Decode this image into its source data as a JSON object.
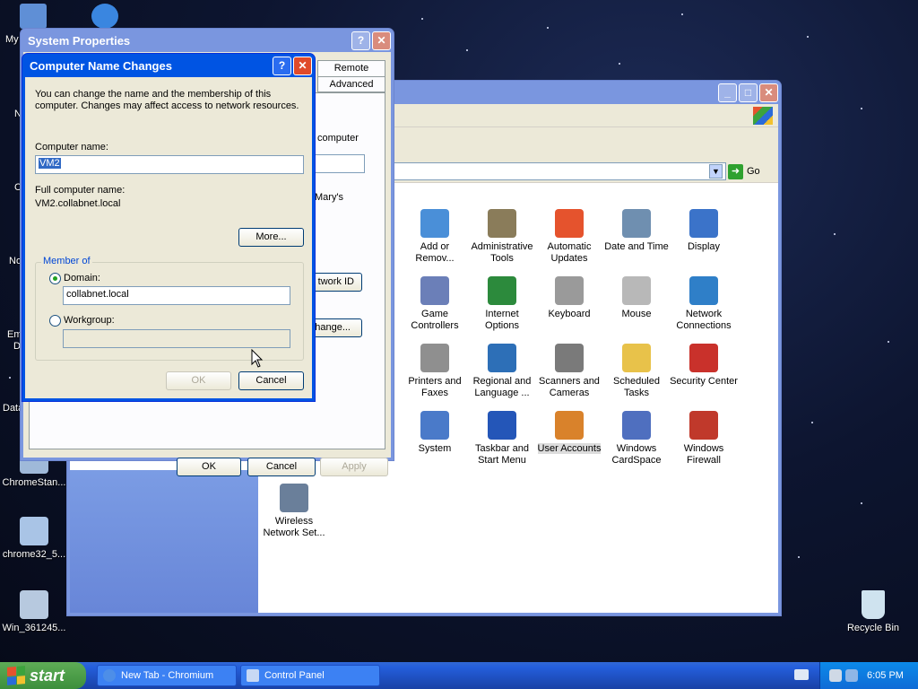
{
  "desktop": {
    "icons": [
      {
        "label": "My"
      },
      {
        "label": "N"
      },
      {
        "label": "C"
      },
      {
        "label": "No"
      },
      {
        "label": "Em"
      },
      {
        "label": "D"
      },
      {
        "label": "Data"
      },
      {
        "label": "ChromeStan..."
      },
      {
        "label": "chrome32_5..."
      },
      {
        "label": "Win_361245..."
      },
      {
        "label": "Recycle Bin"
      }
    ]
  },
  "system_properties": {
    "title": "System Properties",
    "tabs": [
      "Remote",
      "Advanced"
    ],
    "partial_texts": [
      "computer",
      "Mary's",
      "twork ID",
      "hange..."
    ],
    "buttons": {
      "ok": "OK",
      "cancel": "Cancel",
      "apply": "Apply"
    }
  },
  "computer_name_changes": {
    "title": "Computer Name Changes",
    "intro": "You can change the name and the membership of this computer. Changes may affect access to network resources.",
    "computer_name_label": "Computer name:",
    "computer_name_value": "VM2",
    "full_name_label": "Full computer name:",
    "full_name_value": "VM2.collabnet.local",
    "more_button": "More...",
    "member_of_label": "Member of",
    "domain_label": "Domain:",
    "domain_value": "collabnet.local",
    "workgroup_label": "Workgroup:",
    "workgroup_value": "",
    "ok_button": "OK",
    "cancel_button": "Cancel",
    "selected_membership": "Domain"
  },
  "control_panel": {
    "address_go": "Go",
    "items": [
      {
        "label": "Add or Remov...",
        "icon": "add-remove-programs-icon",
        "color": "#4a8fd8"
      },
      {
        "label": "Administrative Tools",
        "icon": "admin-tools-icon",
        "color": "#8a7c5a"
      },
      {
        "label": "Automatic Updates",
        "icon": "windows-flag-icon",
        "color": "#e5532d"
      },
      {
        "label": "Date and Time",
        "icon": "clock-icon",
        "color": "#6f8fb0"
      },
      {
        "label": "Display",
        "icon": "monitor-icon",
        "color": "#3b73c9"
      },
      {
        "label": "Game Controllers",
        "icon": "gamepad-icon",
        "color": "#6b7fb8"
      },
      {
        "label": "Internet Options",
        "icon": "globe-icon",
        "color": "#2c8a3c"
      },
      {
        "label": "Keyboard",
        "icon": "keyboard-icon",
        "color": "#9a9a9a"
      },
      {
        "label": "Mouse",
        "icon": "mouse-icon",
        "color": "#b8b8b8"
      },
      {
        "label": "Network Connections",
        "icon": "network-globe-icon",
        "color": "#2f7fc8"
      },
      {
        "label": "Printers and Faxes",
        "icon": "printer-icon",
        "color": "#8f8f8f"
      },
      {
        "label": "Regional and Language ...",
        "icon": "regional-globe-icon",
        "color": "#2d6fb7"
      },
      {
        "label": "Scanners and Cameras",
        "icon": "scanner-camera-icon",
        "color": "#7a7a7a"
      },
      {
        "label": "Scheduled Tasks",
        "icon": "scheduled-folder-icon",
        "color": "#e8c24a"
      },
      {
        "label": "Security Center",
        "icon": "shield-icon",
        "color": "#c9312b"
      },
      {
        "label": "System",
        "icon": "computer-icon",
        "color": "#4a7ac9"
      },
      {
        "label": "Taskbar and Start Menu",
        "icon": "taskbar-icon",
        "color": "#2456b8"
      },
      {
        "label": "User Accounts",
        "icon": "users-icon",
        "color": "#d9822b"
      },
      {
        "label": "Windows CardSpace",
        "icon": "cardspace-icon",
        "color": "#4f6fbf"
      },
      {
        "label": "Windows Firewall",
        "icon": "firewall-icon",
        "color": "#c0392b"
      },
      {
        "label": "Wireless Network Set...",
        "icon": "wireless-icon",
        "color": "#6a7f9a"
      }
    ],
    "selected_item": "User Accounts"
  },
  "taskbar": {
    "start_label": "start",
    "tasks": [
      {
        "label": "New Tab - Chromium"
      },
      {
        "label": "Control Panel"
      }
    ],
    "clock": "6:05 PM"
  },
  "colors": {
    "xp_blue": "#0054e3",
    "dialog_face": "#ece9d8",
    "start_green": "#3c8f3c"
  }
}
